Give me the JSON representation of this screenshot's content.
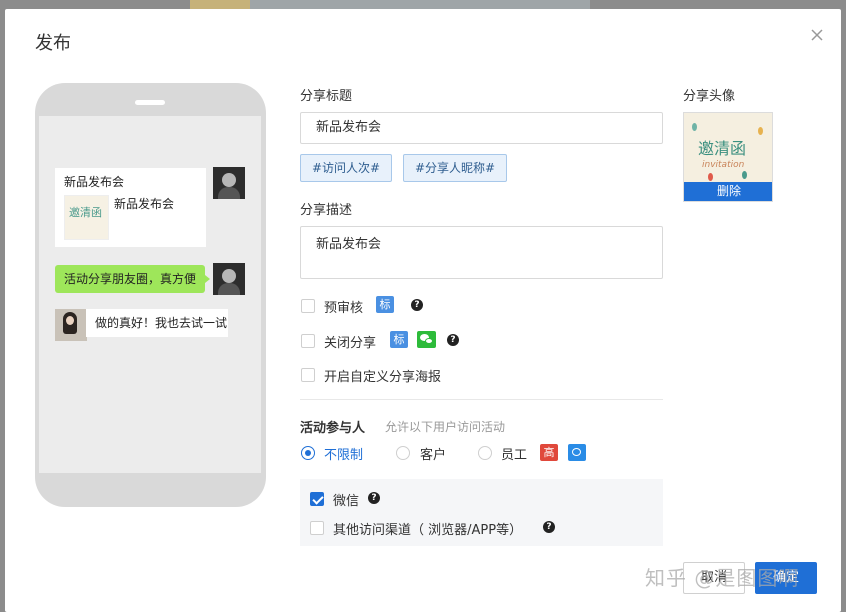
{
  "dialog": {
    "title": "发布"
  },
  "preview": {
    "card_title": "新品发布会",
    "card_desc": "新品发布会",
    "thumb_text": "邀清函",
    "green_message": "活动分享朋友圈，真方便",
    "reply_message": "做的真好！我也去试一试"
  },
  "form": {
    "share_title_label": "分享标题",
    "share_title_value": "新品发布会",
    "tag_buttons": [
      "#访问人次#",
      "#分享人昵称#"
    ],
    "share_desc_label": "分享描述",
    "share_desc_value": "新品发布会",
    "options": {
      "pre_review": "预审核",
      "close_share": "关闭分享",
      "custom_poster": "开启自定义分享海报"
    },
    "badge_biao": "标",
    "participants": {
      "label": "活动参与人",
      "hint": "允许以下用户访问活动",
      "radios": [
        "不限制",
        "客户",
        "员工"
      ],
      "selected": "不限制",
      "badge_gao": "高"
    },
    "channels": {
      "wechat": "微信",
      "others": "其他访问渠道（ 浏览器/APP等）",
      "wechat_checked": true
    }
  },
  "avatar": {
    "label": "分享头像",
    "art_text": "邀清函",
    "art_sub": "invitation",
    "delete_label": "删除"
  },
  "footer": {
    "cancel_label": "取消",
    "confirm_label": "确定"
  },
  "watermark": "知乎 @是图图啊",
  "colors": {
    "primary": "#1f6fd6",
    "green_bubble": "#9ee65a",
    "phone_frame": "#d9d9d9"
  }
}
